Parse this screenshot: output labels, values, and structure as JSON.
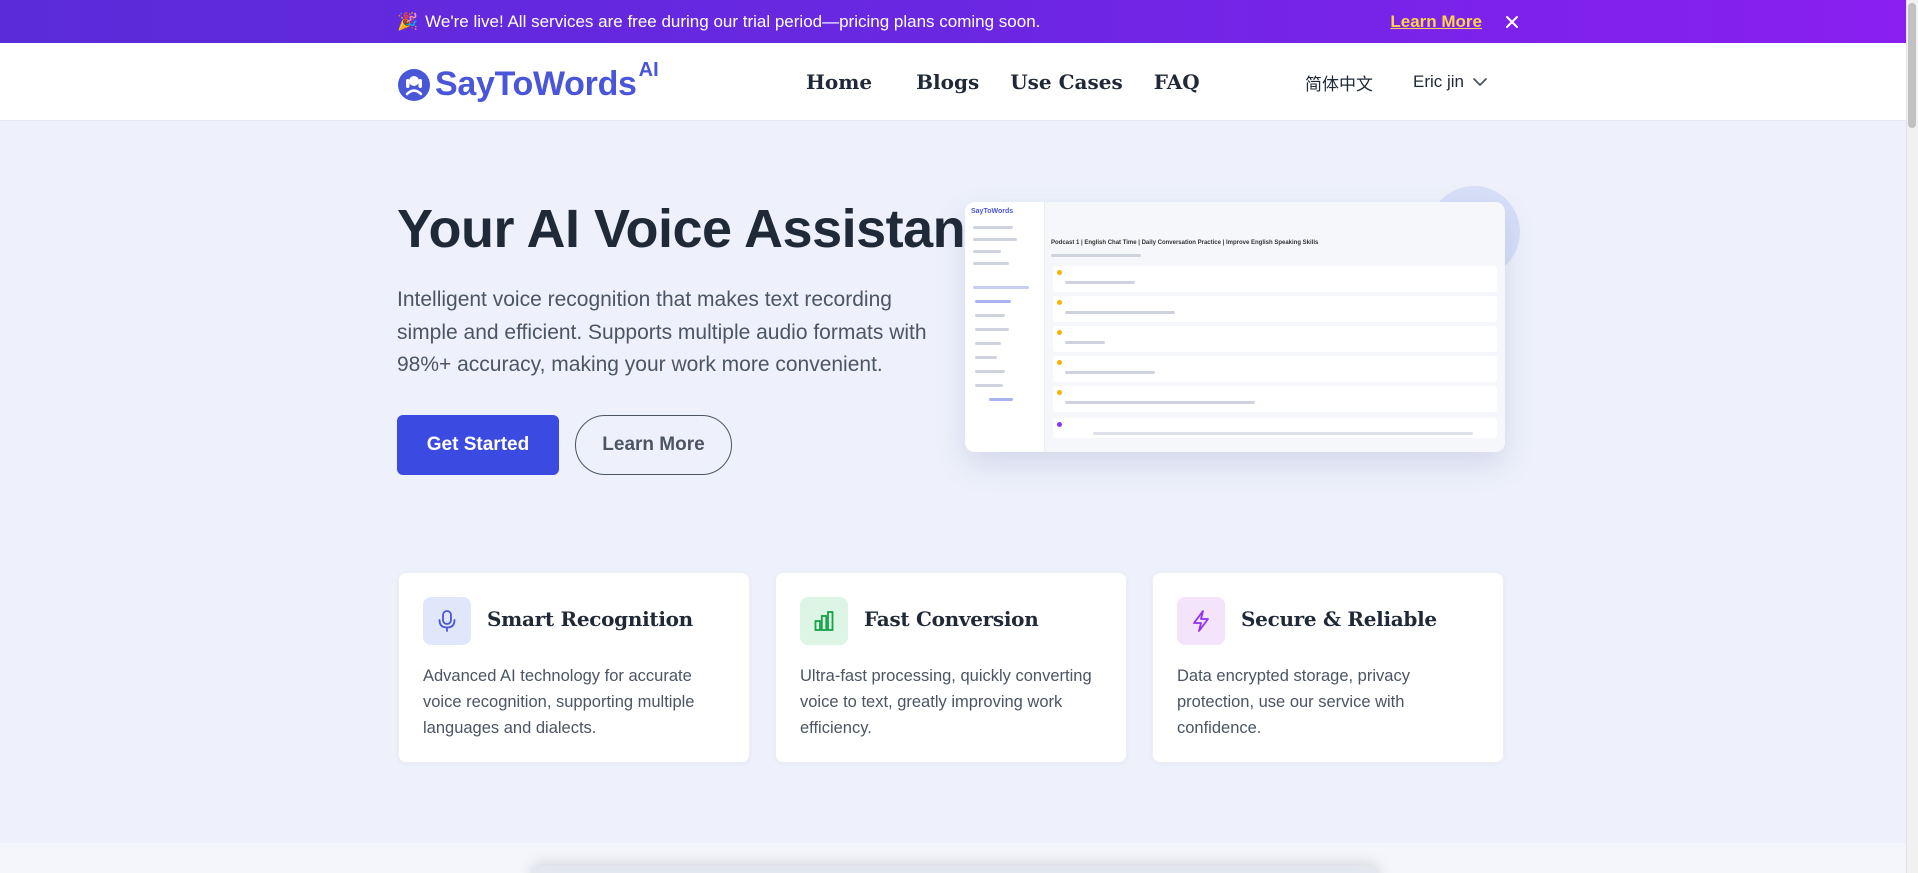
{
  "banner": {
    "emoji": "🎉",
    "text": "We're live! All services are free during our trial period—pricing plans coming soon.",
    "link_label": "Learn More"
  },
  "header": {
    "logo_text": "SayToWords",
    "logo_sup": "AI",
    "nav": [
      "Home",
      "Blogs",
      "Use Cases",
      "FAQ"
    ],
    "language": "简体中文",
    "user_name": "Eric jin"
  },
  "hero": {
    "title": "Your AI Voice Assistant",
    "description": "Intelligent voice recognition that makes text recording simple and efficient. Supports multiple audio formats with 98%+ accuracy, making your work more convenient.",
    "primary_cta": "Get Started",
    "secondary_cta": "Learn More"
  },
  "preview": {
    "title_line": "Podcast 1 | English Chat Time | Daily Conversation Practice | Improve English Speaking Skills",
    "brand": "SayToWords"
  },
  "features": [
    {
      "icon": "microphone-icon",
      "title": "Smart Recognition",
      "description": "Advanced AI technology for accurate voice recognition, supporting multiple languages and dialects.",
      "bg": "#e0e7fb",
      "fg": "#4a56d8"
    },
    {
      "icon": "bar-chart-icon",
      "title": "Fast Conversion",
      "description": "Ultra-fast processing, quickly converting voice to text, greatly improving work efficiency.",
      "bg": "#dcf5e4",
      "fg": "#16a34a"
    },
    {
      "icon": "lightning-icon",
      "title": "Secure & Reliable",
      "description": "Data encrypted storage, privacy protection, use our service with confidence.",
      "bg": "#f3e3fb",
      "fg": "#9333ea"
    }
  ],
  "colors": {
    "brand": "#4a56d8",
    "primary_button": "#3b4ae0",
    "banner_start": "#5b2bd9",
    "banner_end": "#8a1ff0",
    "banner_link": "#fcd34d"
  }
}
